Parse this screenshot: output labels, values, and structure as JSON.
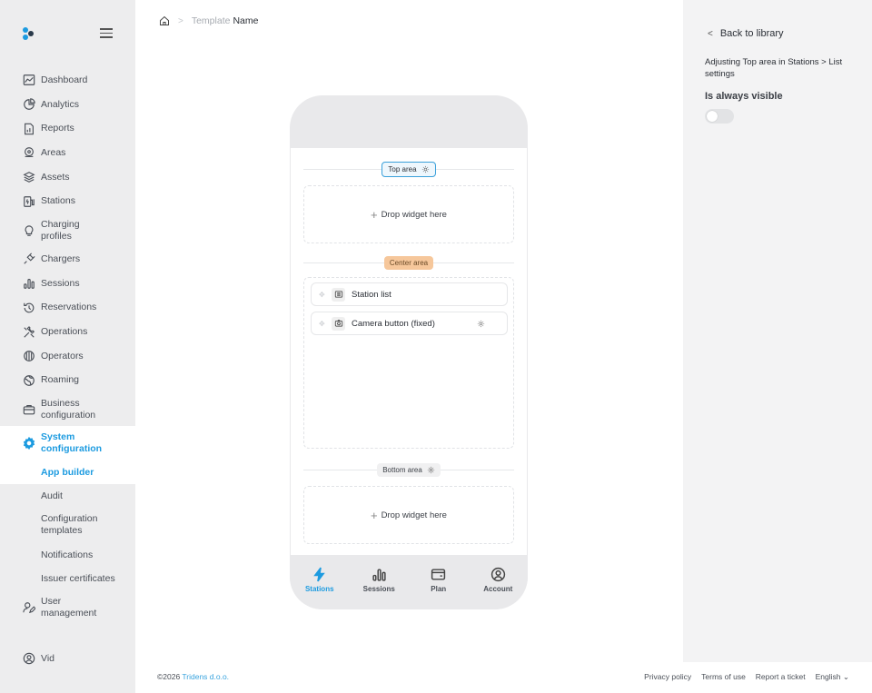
{
  "brand_colors": {
    "accent": "#1d9be0",
    "center_pill": "#f6c79b"
  },
  "sidebar": {
    "items": [
      {
        "label": "Dashboard",
        "icon": "dashboard-icon"
      },
      {
        "label": "Analytics",
        "icon": "pie-chart-icon"
      },
      {
        "label": "Reports",
        "icon": "report-icon"
      },
      {
        "label": "Areas",
        "icon": "map-pin-icon"
      },
      {
        "label": "Assets",
        "icon": "layers-icon"
      },
      {
        "label": "Stations",
        "icon": "station-icon"
      },
      {
        "label": "Charging profiles",
        "icon": "bulb-icon"
      },
      {
        "label": "Chargers",
        "icon": "plug-icon"
      },
      {
        "label": "Sessions",
        "icon": "bar-chart-icon"
      },
      {
        "label": "Reservations",
        "icon": "history-icon"
      },
      {
        "label": "Operations",
        "icon": "tools-icon"
      },
      {
        "label": "Operators",
        "icon": "building-icon"
      },
      {
        "label": "Roaming",
        "icon": "globe-icon"
      },
      {
        "label": "Business configuration",
        "icon": "briefcase-icon"
      },
      {
        "label": "System configuration",
        "icon": "gear-icon"
      }
    ],
    "sub_items": [
      {
        "label": "App builder"
      },
      {
        "label": "Audit"
      },
      {
        "label": "Configuration templates"
      },
      {
        "label": "Notifications"
      },
      {
        "label": "Issuer certificates"
      }
    ],
    "user_management": "User management",
    "user_name": "Vid"
  },
  "breadcrumb": {
    "muted": "Template",
    "current": "Name"
  },
  "phone": {
    "top_area_label": "Top area",
    "center_area_label": "Center area",
    "bottom_area_label": "Bottom area",
    "drop_label": "Drop widget here",
    "widgets": [
      {
        "label": "Station list",
        "icon": "list-icon"
      },
      {
        "label": "Camera button (fixed)",
        "icon": "camera-icon"
      }
    ],
    "tabs": [
      {
        "label": "Stations",
        "icon": "bolt-icon"
      },
      {
        "label": "Sessions",
        "icon": "bar-chart-icon"
      },
      {
        "label": "Plan",
        "icon": "wallet-icon"
      },
      {
        "label": "Account",
        "icon": "account-icon"
      }
    ]
  },
  "right_panel": {
    "back_label": "Back to library",
    "adjusting_text": "Adjusting Top area in Stations > List settings",
    "visible_label": "Is always visible",
    "visible_value": false
  },
  "footer": {
    "copyright": "©2026 ",
    "company": "Tridens d.o.o.",
    "links": [
      "Privacy policy",
      "Terms of use",
      "Report a ticket",
      "English"
    ]
  }
}
